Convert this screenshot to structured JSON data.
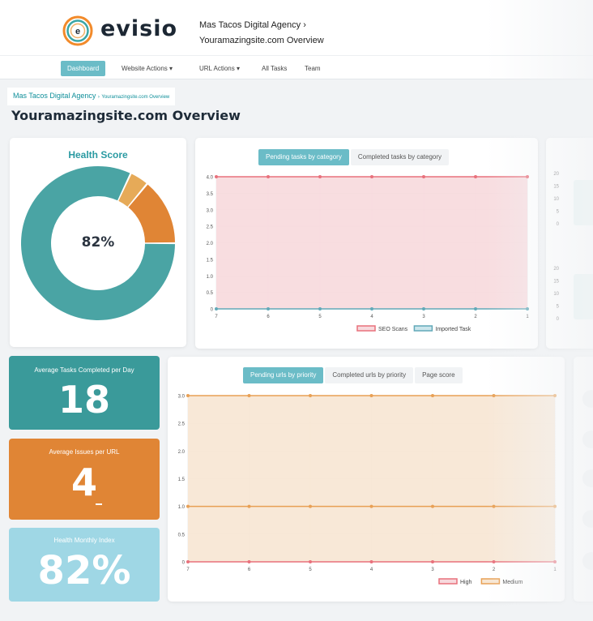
{
  "brand": {
    "name": "evisio"
  },
  "header": {
    "agency": "Mas Tacos Digital Agency",
    "separator": "›",
    "site_overview": "Youramazingsite.com Overview"
  },
  "nav": [
    {
      "label": "Dashboard",
      "active": true
    },
    {
      "label": "Website Actions",
      "caret": "▾"
    },
    {
      "label": "URL Actions",
      "caret": "▾"
    },
    {
      "label": "All Tasks"
    },
    {
      "label": "Team"
    }
  ],
  "breadcrumb": {
    "agency": "Mas Tacos Digital Agency",
    "separator": "›",
    "page": "Youramazingsite.com Overview"
  },
  "page_title": "Youramazingsite.com Overview",
  "health": {
    "title": "Health Score",
    "percent_label": "82%"
  },
  "tasks_card": {
    "tabs": [
      "Pending tasks by category",
      "Completed tasks by category"
    ]
  },
  "urls_card": {
    "tabs": [
      "Pending urls by priority",
      "Completed urls by priority",
      "Page score"
    ]
  },
  "stats": [
    {
      "label": "Average Tasks Completed per Day",
      "value": "18",
      "color": "#3a9a9a"
    },
    {
      "label": "Average Issues per URL",
      "value": "4",
      "color": "#e08535"
    },
    {
      "label": "Health Monthly Index",
      "value": "82%",
      "color": "#9fd7e5"
    }
  ],
  "colors": {
    "accent": "#6bbcc7",
    "teal": "#4aa4a4",
    "orange": "#e08535",
    "red": "#e8717c"
  },
  "chart_data": [
    {
      "type": "pie",
      "title": "Health Score",
      "slices": [
        {
          "value": 82,
          "color": "#4aa4a4"
        },
        {
          "value": 4,
          "color": "#e6aa58"
        },
        {
          "value": 14,
          "color": "#e08535"
        }
      ],
      "center_label": "82%"
    },
    {
      "type": "area",
      "categories": [
        "7",
        "6",
        "5",
        "4",
        "3",
        "2",
        "1"
      ],
      "yticks": [
        "0",
        "0.5",
        "1.0",
        "1.5",
        "2.0",
        "2.5",
        "3.0",
        "3.5",
        "4.0"
      ],
      "ylim": [
        0,
        4
      ],
      "grid": true,
      "legend_position": "bottom",
      "series": [
        {
          "name": "SEO Scans",
          "values": [
            4,
            4,
            4,
            4,
            4,
            4,
            4
          ],
          "color": "#e8717c",
          "fill": "#f7d9dd"
        },
        {
          "name": "Imported Task",
          "values": [
            0,
            0,
            0,
            0,
            0,
            0,
            0
          ],
          "color": "#62a9b8",
          "fill": "#cbe6ec"
        }
      ]
    },
    {
      "type": "area",
      "categories": [
        "7",
        "6",
        "5",
        "4",
        "3",
        "2",
        "1"
      ],
      "yticks": [
        "0",
        "0.5",
        "1.0",
        "1.5",
        "2.0",
        "2.5",
        "3.0"
      ],
      "ylim": [
        0,
        3
      ],
      "grid": true,
      "legend_position": "bottom",
      "series": [
        {
          "name": "High",
          "values": [
            0,
            0,
            0,
            0,
            0,
            0,
            0
          ],
          "color": "#e8717c",
          "fill": "#f7d9dd"
        },
        {
          "name": "Medium",
          "values": [
            3,
            3,
            3,
            3,
            3,
            3,
            3
          ],
          "color": "#e8a055",
          "fill": "#f7e6d3"
        },
        {
          "values": [
            1,
            1,
            1,
            1,
            1,
            1,
            1
          ],
          "color": "#e8a055"
        }
      ]
    }
  ],
  "partial_chart": {
    "top_ticks": [
      "20",
      "15",
      "10",
      "5",
      "0"
    ],
    "bottom_ticks": [
      "20",
      "15",
      "10",
      "5",
      "0"
    ]
  }
}
